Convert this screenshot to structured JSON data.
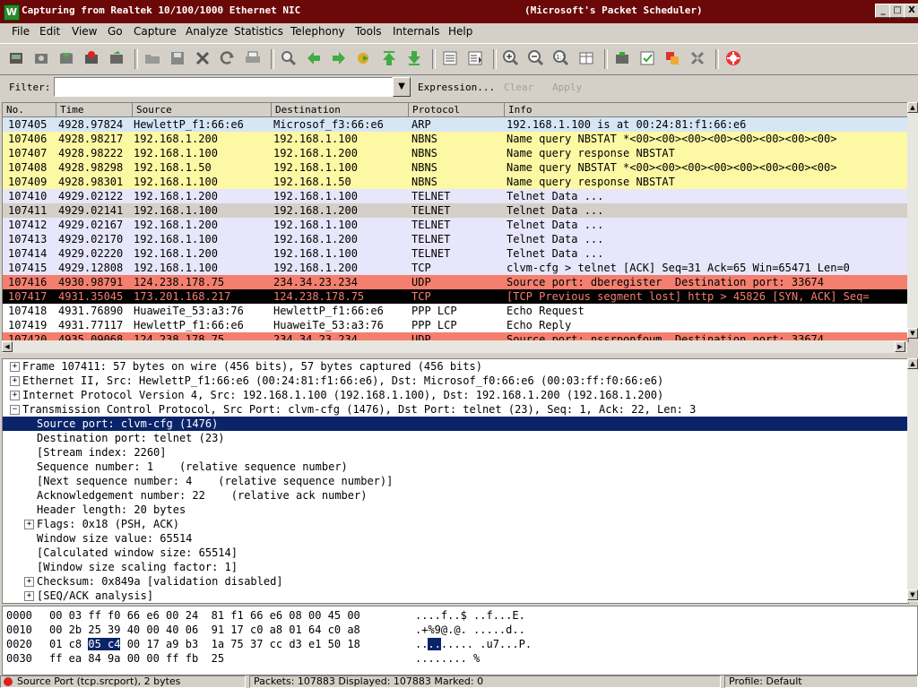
{
  "window": {
    "title": "Capturing from Realtek 10/100/1000 Ethernet NIC",
    "title_right": "(Microsoft's Packet Scheduler)",
    "minimize": "_",
    "maximize": "□",
    "close": "X"
  },
  "menu": [
    "File",
    "Edit",
    "View",
    "Go",
    "Capture",
    "Analyze",
    "Statistics",
    "Telephony",
    "Tools",
    "Internals",
    "Help"
  ],
  "filter": {
    "label": "Filter:",
    "value": "",
    "expression_label": "Expression...",
    "clear_label": "Clear",
    "apply_label": "Apply"
  },
  "packet_list": {
    "columns": [
      "No.",
      "Time",
      "Source",
      "Destination",
      "Protocol",
      "Info"
    ],
    "rows": [
      {
        "no": "107405",
        "time": "4928.97824",
        "src": "HewlettP_f1:66:e6",
        "dst": "Microsof_f3:66:e6",
        "proto": "ARP",
        "info": "192.168.1.100 is at 00:24:81:f1:66:e6",
        "bg": "#d6e6f5",
        "fg": "#000000"
      },
      {
        "no": "107406",
        "time": "4928.98217",
        "src": "192.168.1.200",
        "dst": "192.168.1.100",
        "proto": "NBNS",
        "info": "Name query NBSTAT *<00><00><00><00><00><00><00><00>",
        "bg": "#fdf8a3",
        "fg": "#000000"
      },
      {
        "no": "107407",
        "time": "4928.98222",
        "src": "192.168.1.100",
        "dst": "192.168.1.200",
        "proto": "NBNS",
        "info": "Name query response NBSTAT",
        "bg": "#fdf8a3",
        "fg": "#000000"
      },
      {
        "no": "107408",
        "time": "4928.98298",
        "src": "192.168.1.50",
        "dst": "192.168.1.100",
        "proto": "NBNS",
        "info": "Name query NBSTAT *<00><00><00><00><00><00><00><00>",
        "bg": "#fdf8a3",
        "fg": "#000000"
      },
      {
        "no": "107409",
        "time": "4928.98301",
        "src": "192.168.1.100",
        "dst": "192.168.1.50",
        "proto": "NBNS",
        "info": "Name query response NBSTAT",
        "bg": "#fdf8a3",
        "fg": "#000000"
      },
      {
        "no": "107410",
        "time": "4929.02122",
        "src": "192.168.1.200",
        "dst": "192.168.1.100",
        "proto": "TELNET",
        "info": "Telnet Data ...",
        "bg": "#e7e6fa",
        "fg": "#000000"
      },
      {
        "no": "107411",
        "time": "4929.02141",
        "src": "192.168.1.100",
        "dst": "192.168.1.200",
        "proto": "TELNET",
        "info": "Telnet Data ...",
        "bg": "#d4d0c8",
        "fg": "#000000"
      },
      {
        "no": "107412",
        "time": "4929.02167",
        "src": "192.168.1.200",
        "dst": "192.168.1.100",
        "proto": "TELNET",
        "info": "Telnet Data ...",
        "bg": "#e7e6fa",
        "fg": "#000000"
      },
      {
        "no": "107413",
        "time": "4929.02170",
        "src": "192.168.1.100",
        "dst": "192.168.1.200",
        "proto": "TELNET",
        "info": "Telnet Data ...",
        "bg": "#e7e6fa",
        "fg": "#000000"
      },
      {
        "no": "107414",
        "time": "4929.02220",
        "src": "192.168.1.200",
        "dst": "192.168.1.100",
        "proto": "TELNET",
        "info": "Telnet Data ...",
        "bg": "#e7e6fa",
        "fg": "#000000"
      },
      {
        "no": "107415",
        "time": "4929.12808",
        "src": "192.168.1.100",
        "dst": "192.168.1.200",
        "proto": "TCP",
        "info": "clvm-cfg > telnet [ACK] Seq=31 Ack=65 Win=65471 Len=0",
        "bg": "#e7e6fa",
        "fg": "#000000"
      },
      {
        "no": "107416",
        "time": "4930.98791",
        "src": "124.238.178.75",
        "dst": "234.34.23.234",
        "proto": "UDP",
        "info": "Source port: dberegister  Destination port: 33674",
        "bg": "#f47f6f",
        "fg": "#000000"
      },
      {
        "no": "107417",
        "time": "4931.35045",
        "src": "173.201.168.217",
        "dst": "124.238.178.75",
        "proto": "TCP",
        "info": "[TCP Previous segment lost] http > 45826 [SYN, ACK] Seq=",
        "bg": "#000000",
        "fg": "#f47f6f"
      },
      {
        "no": "107418",
        "time": "4931.76890",
        "src": "HuaweiTe_53:a3:76",
        "dst": "HewlettP_f1:66:e6",
        "proto": "PPP LCP",
        "info": "Echo Request",
        "bg": "#ffffff",
        "fg": "#000000"
      },
      {
        "no": "107419",
        "time": "4931.77117",
        "src": "HewlettP_f1:66:e6",
        "dst": "HuaweiTe_53:a3:76",
        "proto": "PPP LCP",
        "info": "Echo Reply",
        "bg": "#ffffff",
        "fg": "#000000"
      },
      {
        "no": "107420",
        "time": "4935.09068",
        "src": "124.238.178.75",
        "dst": "234.34.23.234",
        "proto": "UDP",
        "info": "Source port: nssrponfoum  Destination port: 33674",
        "bg": "#f47f6f",
        "fg": "#000000"
      }
    ]
  },
  "details": [
    {
      "indent": 0,
      "exp": "+",
      "text": "Frame 107411: 57 bytes on wire (456 bits), 57 bytes captured (456 bits)",
      "selected": false
    },
    {
      "indent": 0,
      "exp": "+",
      "text": "Ethernet II, Src: HewlettP_f1:66:e6 (00:24:81:f1:66:e6), Dst: Microsof_f0:66:e6 (00:03:ff:f0:66:e6)",
      "selected": false
    },
    {
      "indent": 0,
      "exp": "+",
      "text": "Internet Protocol Version 4, Src: 192.168.1.100 (192.168.1.100), Dst: 192.168.1.200 (192.168.1.200)",
      "selected": false
    },
    {
      "indent": 0,
      "exp": "-",
      "text": "Transmission Control Protocol, Src Port: clvm-cfg (1476), Dst Port: telnet (23), Seq: 1, Ack: 22, Len: 3",
      "selected": false
    },
    {
      "indent": 1,
      "exp": "",
      "text": "Source port: clvm-cfg (1476)",
      "selected": true
    },
    {
      "indent": 1,
      "exp": "",
      "text": "Destination port: telnet (23)",
      "selected": false
    },
    {
      "indent": 1,
      "exp": "",
      "text": "[Stream index: 2260]",
      "selected": false
    },
    {
      "indent": 1,
      "exp": "",
      "text": "Sequence number: 1    (relative sequence number)",
      "selected": false
    },
    {
      "indent": 1,
      "exp": "",
      "text": "[Next sequence number: 4    (relative sequence number)]",
      "selected": false
    },
    {
      "indent": 1,
      "exp": "",
      "text": "Acknowledgement number: 22    (relative ack number)",
      "selected": false
    },
    {
      "indent": 1,
      "exp": "",
      "text": "Header length: 20 bytes",
      "selected": false
    },
    {
      "indent": 1,
      "exp": "+",
      "text": "Flags: 0x18 (PSH, ACK)",
      "selected": false
    },
    {
      "indent": 1,
      "exp": "",
      "text": "Window size value: 65514",
      "selected": false
    },
    {
      "indent": 1,
      "exp": "",
      "text": "[Calculated window size: 65514]",
      "selected": false
    },
    {
      "indent": 1,
      "exp": "",
      "text": "[Window size scaling factor: 1]",
      "selected": false
    },
    {
      "indent": 1,
      "exp": "+",
      "text": "Checksum: 0x849a [validation disabled]",
      "selected": false
    },
    {
      "indent": 1,
      "exp": "+",
      "text": "[SEQ/ACK analysis]",
      "selected": false
    }
  ],
  "hex": [
    {
      "offset": "0000",
      "pre": "00 03 ff f0 66 e6 00 24  81 f1 66 e6 08 00 45 00",
      "hl": "",
      "post": "",
      "ascii_pre": "....f..$ ..f...E.",
      "ascii_hl": "",
      "ascii_post": ""
    },
    {
      "offset": "0010",
      "pre": "00 2b 25 39 40 00 40 06  91 17 c0 a8 01 64 c0 a8",
      "hl": "",
      "post": "",
      "ascii_pre": ".+%9@.@. .....d..",
      "ascii_hl": "",
      "ascii_post": ""
    },
    {
      "offset": "0020",
      "pre": "01 c8 ",
      "hl": "05 c4",
      "post": " 00 17 a9 b3  1a 75 37 cc d3 e1 50 18",
      "ascii_pre": "..",
      "ascii_hl": "..",
      "ascii_post": "..... .u7...P."
    },
    {
      "offset": "0030",
      "pre": "ff ea 84 9a 00 00 ff fb  25",
      "hl": "",
      "post": "",
      "ascii_pre": "........ %",
      "ascii_hl": "",
      "ascii_post": ""
    }
  ],
  "status": {
    "field": "Source Port (tcp.srcport), 2 bytes",
    "packets": "Packets: 107883 Displayed: 107883 Marked: 0",
    "profile": "Profile: Default"
  },
  "colors": {
    "title_bar": "#6b0808",
    "selection": "#0a246a",
    "nbns": "#fdf8a3",
    "tcp": "#e7e6fa",
    "udp_error": "#f47f6f"
  }
}
